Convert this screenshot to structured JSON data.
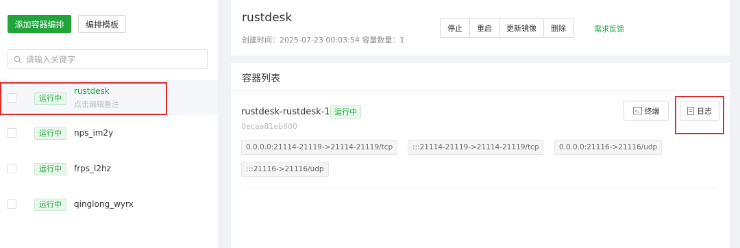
{
  "sidebar": {
    "add_button": "添加容器编排",
    "template_button": "编排模板",
    "search_placeholder": "请输入关键字",
    "items": [
      {
        "status": "运行中",
        "name": "rustdesk",
        "note": "点击编辑备注"
      },
      {
        "status": "运行中",
        "name": "nps_im2y"
      },
      {
        "status": "运行中",
        "name": "frps_l2hz"
      },
      {
        "status": "运行中",
        "name": "qinglong_wyrx"
      }
    ]
  },
  "header": {
    "title": "rustdesk",
    "meta": "创建时间：2025-07-23 00:03:54   容量数量：1",
    "actions": [
      "停止",
      "重启",
      "更新镜像",
      "删除"
    ],
    "feedback": "需求反馈"
  },
  "container_list": {
    "title": "容器列表",
    "container": {
      "name": "rustdesk-rustdesk-1",
      "status": "运行中",
      "id": "0ecaa81eb600",
      "ports": [
        "0.0.0.0:21114-21119->21114-21119/tcp",
        ":::21114-21119->21114-21119/tcp",
        "0.0.0.0:21116->21116/udp",
        ":::21116->21116/udp"
      ],
      "terminal_button": "终端",
      "log_button": "日志"
    }
  },
  "colors": {
    "accent": "#20a53a",
    "highlight_border": "#e02a2a"
  },
  "icons": [
    "search-icon",
    "terminal-icon",
    "log-icon"
  ]
}
